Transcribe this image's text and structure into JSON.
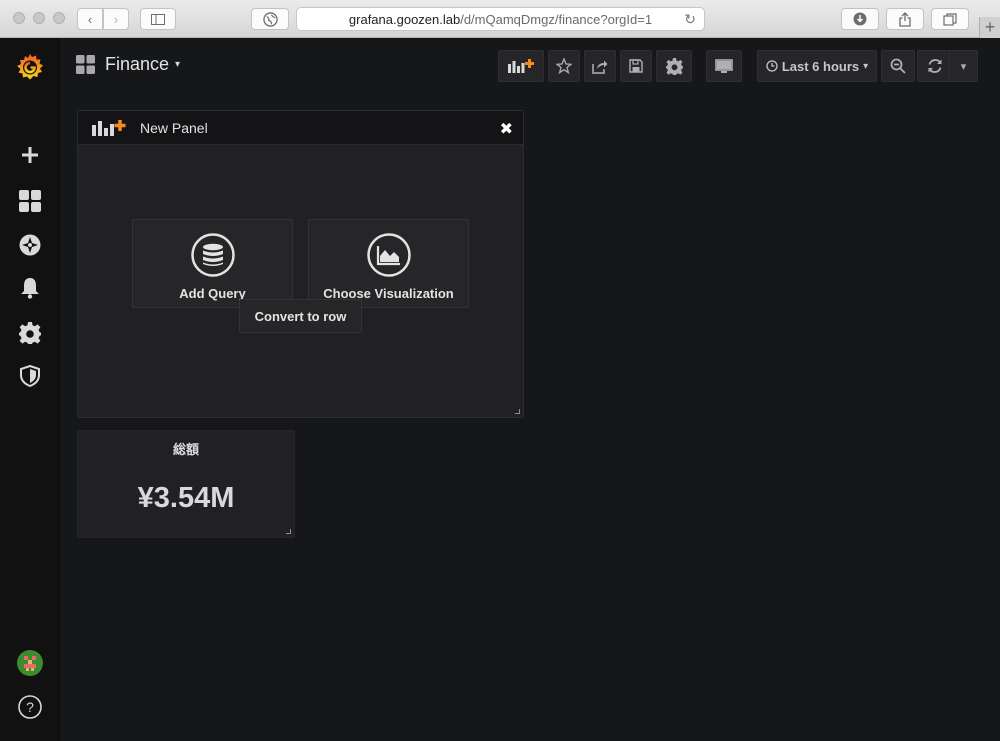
{
  "browser": {
    "url_host": "grafana.goozen.lab",
    "url_path": "/d/mQamqDmgz/finance?orgId=1"
  },
  "navbar": {
    "dashboard_title": "Finance",
    "time_range_label": "Last 6 hours"
  },
  "new_panel": {
    "title": "New Panel",
    "add_query_label": "Add Query",
    "choose_visualization_label": "Choose Visualization",
    "convert_to_row_label": "Convert to row"
  },
  "stat_panel": {
    "title": "総額",
    "value": "¥3.54M"
  },
  "colors": {
    "brand_orange": "#f68a1f",
    "background": "#161719",
    "panel_bg": "#212124"
  }
}
